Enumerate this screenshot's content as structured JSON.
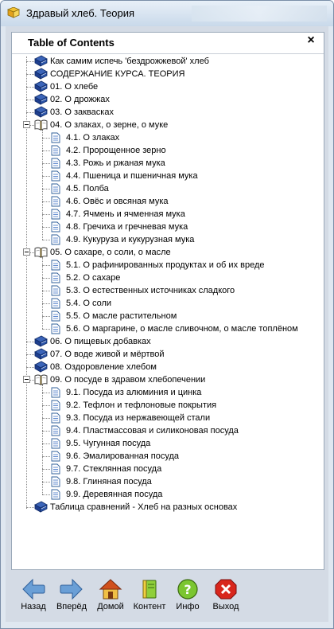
{
  "window": {
    "title": "Здравый хлеб. Теория"
  },
  "toc": {
    "title": "Table of Contents",
    "close_label": "×"
  },
  "tree": [
    {
      "level": 0,
      "kind": "book",
      "label": "Как самим испечь 'бездрожжевой' хлеб"
    },
    {
      "level": 0,
      "kind": "book",
      "label": "СОДЕРЖАНИЕ КУРСА. ТЕОРИЯ"
    },
    {
      "level": 0,
      "kind": "book",
      "label": "01. О хлебе"
    },
    {
      "level": 0,
      "kind": "book",
      "label": "02. О дрожжах"
    },
    {
      "level": 0,
      "kind": "book",
      "label": "03. О заквасках"
    },
    {
      "level": 0,
      "kind": "open-book",
      "expanded": true,
      "label": "04. О злаках, о зерне, о муке"
    },
    {
      "level": 1,
      "kind": "page",
      "label": "4.1. О злаках"
    },
    {
      "level": 1,
      "kind": "page",
      "label": "4.2. Пророщенное зерно"
    },
    {
      "level": 1,
      "kind": "page",
      "label": "4.3. Рожь и ржаная мука"
    },
    {
      "level": 1,
      "kind": "page",
      "label": "4.4. Пшеница и пшеничная мука"
    },
    {
      "level": 1,
      "kind": "page",
      "label": "4.5. Полба"
    },
    {
      "level": 1,
      "kind": "page",
      "label": "4.6. Овёс и овсяная мука"
    },
    {
      "level": 1,
      "kind": "page",
      "label": "4.7. Ячмень и ячменная мука"
    },
    {
      "level": 1,
      "kind": "page",
      "label": "4.8. Гречиха и гречневая мука"
    },
    {
      "level": 1,
      "kind": "page",
      "label": "4.9. Кукуруза и кукурузная мука"
    },
    {
      "level": 0,
      "kind": "open-book",
      "expanded": true,
      "label": "05. О сахаре, о соли, о масле"
    },
    {
      "level": 1,
      "kind": "page",
      "label": "5.1. О рафинированных продуктах и об их вреде"
    },
    {
      "level": 1,
      "kind": "page",
      "label": "5.2. О сахаре"
    },
    {
      "level": 1,
      "kind": "page",
      "label": "5.3. О естественных источниках сладкого"
    },
    {
      "level": 1,
      "kind": "page",
      "label": "5.4. О соли"
    },
    {
      "level": 1,
      "kind": "page",
      "label": "5.5. О масле растительном"
    },
    {
      "level": 1,
      "kind": "page",
      "label": "5.6. О маргарине, о масле сливочном, о масле топлёном"
    },
    {
      "level": 0,
      "kind": "book",
      "label": "06. О пищевых добавках"
    },
    {
      "level": 0,
      "kind": "book",
      "label": "07. О воде живой и мёртвой"
    },
    {
      "level": 0,
      "kind": "book",
      "label": "08. Оздоровление хлебом"
    },
    {
      "level": 0,
      "kind": "open-book",
      "expanded": true,
      "label": "09. О посуде в здравом хлебопечении"
    },
    {
      "level": 1,
      "kind": "page",
      "label": "9.1. Посуда из алюминия и цинка"
    },
    {
      "level": 1,
      "kind": "page",
      "label": "9.2. Тефлон и тефлоновые покрытия"
    },
    {
      "level": 1,
      "kind": "page",
      "label": "9.3. Посуда из нержавеющей стали"
    },
    {
      "level": 1,
      "kind": "page",
      "label": "9.4. Пластмассовая и силиконовая посуда"
    },
    {
      "level": 1,
      "kind": "page",
      "label": "9.5. Чугунная посуда"
    },
    {
      "level": 1,
      "kind": "page",
      "label": "9.6. Эмалированная посуда"
    },
    {
      "level": 1,
      "kind": "page",
      "label": "9.7. Стеклянная посуда"
    },
    {
      "level": 1,
      "kind": "page",
      "label": "9.8. Глиняная посуда"
    },
    {
      "level": 1,
      "kind": "page",
      "label": "9.9. Деревянная посуда"
    },
    {
      "level": 0,
      "kind": "book",
      "label": "Таблица сравнений - Хлеб на разных основах"
    }
  ],
  "toolbar": {
    "back_label": "Назад",
    "forward_label": "Вперёд",
    "home_label": "Домой",
    "content_label": "Контент",
    "info_label": "Инфо",
    "exit_label": "Выход"
  },
  "colors": {
    "book": "#1e3f8f",
    "page": "#3b6fc4",
    "arrow": "#5b8fc9",
    "home": "#c8501e",
    "info": "#6fbf2a",
    "exit": "#d8261c"
  }
}
